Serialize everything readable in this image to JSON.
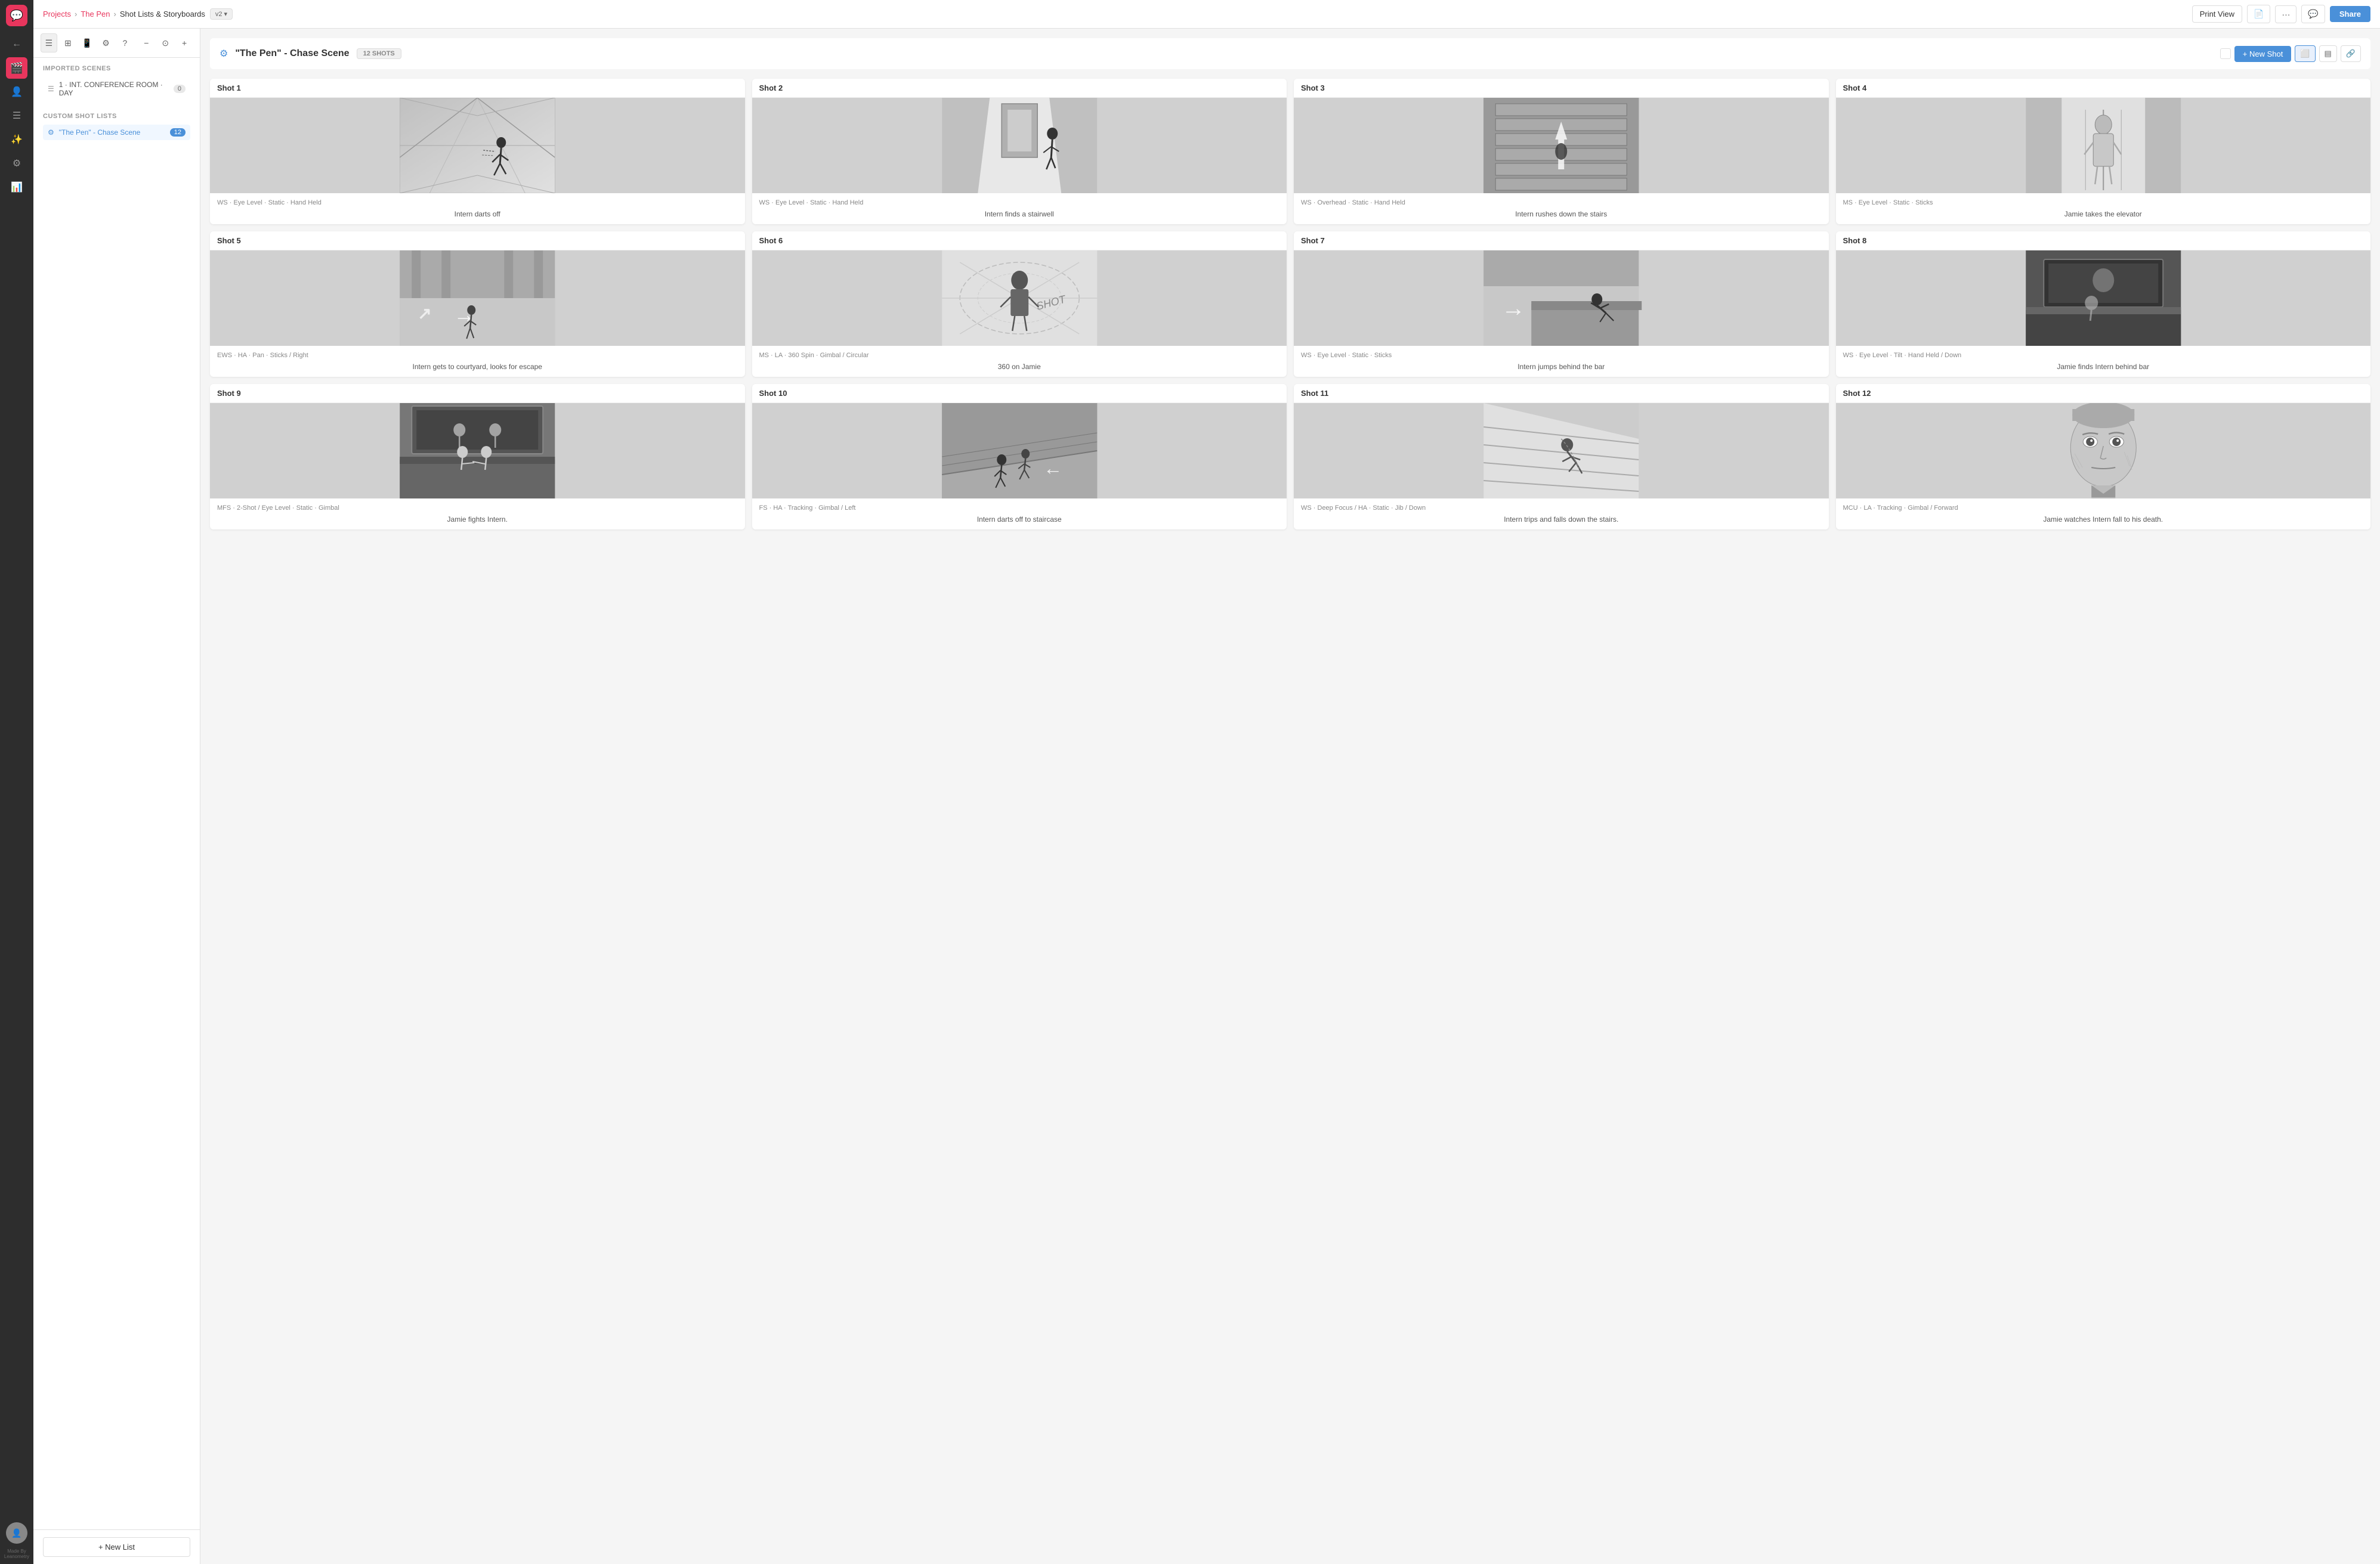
{
  "app": {
    "title": "Leanometry",
    "logo_icon": "💬"
  },
  "nav": {
    "back_icon": "←",
    "items": [
      {
        "id": "home",
        "icon": "⊞",
        "active": false
      },
      {
        "id": "user",
        "icon": "👤",
        "active": false
      },
      {
        "id": "list",
        "icon": "☰",
        "active": false
      },
      {
        "id": "scene",
        "icon": "🎬",
        "active": true
      },
      {
        "id": "sliders",
        "icon": "⚙",
        "active": false
      },
      {
        "id": "chart",
        "icon": "📊",
        "active": false
      }
    ],
    "made_by": "Made By\nLeanometry"
  },
  "header": {
    "projects_label": "Projects",
    "project_name": "The Pen",
    "page_title": "Shot Lists & Storyboards",
    "version": "v2",
    "print_view_label": "Print View",
    "share_label": "Share"
  },
  "sidebar": {
    "tools": [
      {
        "id": "list-view",
        "icon": "☰",
        "active": true
      },
      {
        "id": "grid-view",
        "icon": "⊞",
        "active": false
      },
      {
        "id": "mobile-view",
        "icon": "📱",
        "active": false
      },
      {
        "id": "settings",
        "icon": "⚙",
        "active": false
      },
      {
        "id": "help",
        "icon": "?",
        "active": false
      }
    ],
    "imported_scenes_title": "IMPORTED SCENES",
    "scene_item": {
      "icon": "☰",
      "label": "1 · INT. CONFERENCE ROOM · DAY",
      "count": "0"
    },
    "custom_shot_lists_title": "CUSTOM SHOT LISTS",
    "shot_list_item": {
      "icon": "🎬",
      "label": "\"The Pen\" - Chase Scene",
      "count": "12"
    },
    "new_list_label": "+ New List"
  },
  "scene": {
    "icon": "⚙",
    "title": "\"The Pen\" - Chase Scene",
    "shots_badge": "12 SHOTS",
    "new_shot_label": "+ New Shot",
    "shots": [
      {
        "id": "shot-1",
        "label": "Shot 1",
        "specs": "WS · Eye Level · Static · Hand Held",
        "description": "Intern darts off",
        "sketch_class": "s1"
      },
      {
        "id": "shot-2",
        "label": "Shot 2",
        "specs": "WS · Eye Level · Static · Hand Held",
        "description": "Intern finds a stairwell",
        "sketch_class": "s2"
      },
      {
        "id": "shot-3",
        "label": "Shot 3",
        "specs": "WS · Overhead · Static · Hand Held",
        "description": "Intern rushes down the stairs",
        "sketch_class": "s3"
      },
      {
        "id": "shot-4",
        "label": "Shot 4",
        "specs": "MS · Eye Level · Static · Sticks",
        "description": "Jamie takes the elevator",
        "sketch_class": "s4"
      },
      {
        "id": "shot-5",
        "label": "Shot 5",
        "specs": "EWS · HA · Pan · Sticks / Right",
        "description": "Intern gets to courtyard, looks for escape",
        "sketch_class": "s5"
      },
      {
        "id": "shot-6",
        "label": "Shot 6",
        "specs": "MS · LA · 360 Spin · Gimbal / Circular",
        "description": "360 on Jamie",
        "sketch_class": "s6"
      },
      {
        "id": "shot-7",
        "label": "Shot 7",
        "specs": "WS · Eye Level · Static · Sticks",
        "description": "Intern jumps behind the bar",
        "sketch_class": "s7"
      },
      {
        "id": "shot-8",
        "label": "Shot 8",
        "specs": "WS · Eye Level · Tilt · Hand Held / Down",
        "description": "Jamie finds Intern behind bar",
        "sketch_class": "s8"
      },
      {
        "id": "shot-9",
        "label": "Shot 9",
        "specs": "MFS · 2-Shot / Eye Level · Static · Gimbal",
        "description": "Jamie fights Intern.",
        "sketch_class": "s9"
      },
      {
        "id": "shot-10",
        "label": "Shot 10",
        "specs": "FS · HA · Tracking · Gimbal / Left",
        "description": "Intern darts off to staircase",
        "sketch_class": "s10"
      },
      {
        "id": "shot-11",
        "label": "Shot 11",
        "specs": "WS · Deep Focus / HA · Static · Jib / Down",
        "description": "Intern trips and falls down the stairs.",
        "sketch_class": "s11"
      },
      {
        "id": "shot-12",
        "label": "Shot 12",
        "specs": "MCU · LA · Tracking · Gimbal / Forward",
        "description": "Jamie watches Intern fall to his death.",
        "sketch_class": "s12"
      }
    ]
  }
}
